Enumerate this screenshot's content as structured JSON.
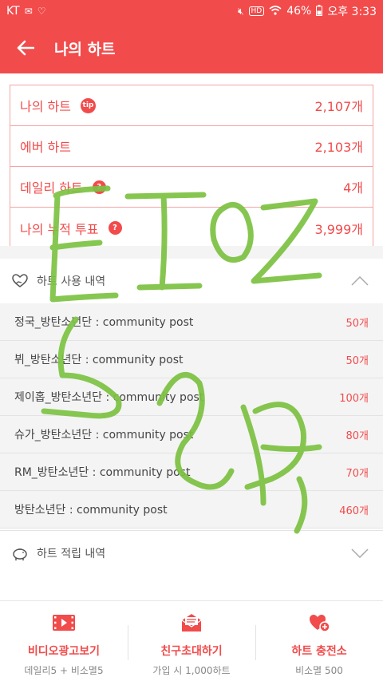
{
  "status_bar": {
    "carrier": "KT",
    "battery": "46%",
    "time": "오후 3:33",
    "hd": "HD"
  },
  "header": {
    "title": "나의 하트"
  },
  "summary": [
    {
      "label": "나의 하트",
      "badge": "tip",
      "value": "2,107개"
    },
    {
      "label": "에버 하트",
      "badge": "",
      "value": "2,103개"
    },
    {
      "label": "데일리 하트",
      "badge": "?",
      "value": "4개"
    },
    {
      "label": "나의 누적 투표",
      "badge": "?",
      "value": "3,999개"
    }
  ],
  "usage_section": {
    "title": "하트 사용 내역",
    "items": [
      {
        "desc": "정국_방탄소년단 : community post",
        "amount": "50개"
      },
      {
        "desc": "뷔_방탄소년단 : community post",
        "amount": "50개"
      },
      {
        "desc": "제이홉_방탄소년단 : community post",
        "amount": "100개"
      },
      {
        "desc": "슈가_방탄소년단 : community post",
        "amount": "80개"
      },
      {
        "desc": "RM_방탄소년단 : community post",
        "amount": "70개"
      },
      {
        "desc": "방탄소년단 : community post",
        "amount": "460개"
      }
    ]
  },
  "earn_section": {
    "title": "하트 적립 내역"
  },
  "footer": [
    {
      "label": "비디오광고보기",
      "sub": "데일리5 + 비소멸5",
      "icon": "video-icon"
    },
    {
      "label": "친구초대하기",
      "sub": "가입 시 1,000하트",
      "icon": "invite-mail-icon"
    },
    {
      "label": "하트 충전소",
      "sub": "비소멸 500",
      "icon": "heart-plus-icon"
    }
  ],
  "colors": {
    "accent": "#f24b4b",
    "scribble": "#7cc242"
  }
}
